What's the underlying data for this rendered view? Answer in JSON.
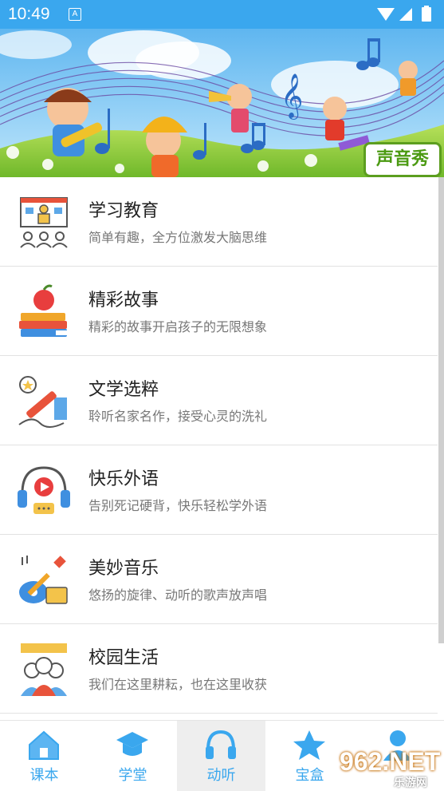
{
  "status_bar": {
    "time": "10:49",
    "notification_badge": "A"
  },
  "banner": {
    "badge_text": "声音秀"
  },
  "list": {
    "items": [
      {
        "title": "学习教育",
        "subtitle": "简单有趣，全方位激发大脑思维",
        "icon": "classroom-icon"
      },
      {
        "title": "精彩故事",
        "subtitle": "精彩的故事开启孩子的无限想象",
        "icon": "books-apple-icon"
      },
      {
        "title": "文学选粹",
        "subtitle": "聆听名家名作，接受心灵的洗礼",
        "icon": "pen-writing-icon"
      },
      {
        "title": "快乐外语",
        "subtitle": "告别死记硬背，快乐轻松学外语",
        "icon": "headphones-play-icon"
      },
      {
        "title": "美妙音乐",
        "subtitle": "悠扬的旋律、动听的歌声放声唱",
        "icon": "guitar-icon"
      },
      {
        "title": "校园生活",
        "subtitle": "我们在这里耕耘，也在这里收获",
        "icon": "students-icon"
      }
    ]
  },
  "tabbar": {
    "tabs": [
      {
        "label": "课本",
        "icon": "house-icon",
        "active": false
      },
      {
        "label": "学堂",
        "icon": "graduation-cap-icon",
        "active": false
      },
      {
        "label": "动听",
        "icon": "headphones-icon",
        "active": true
      },
      {
        "label": "宝盒",
        "icon": "star-icon",
        "active": false
      },
      {
        "label": "",
        "icon": "user-icon",
        "active": false
      }
    ]
  },
  "watermark": {
    "big": "962.NET",
    "small": "乐游网"
  },
  "colors": {
    "accent": "#3aa7ee",
    "title_text": "#222222",
    "subtitle_text": "#777777",
    "divider": "#e2e2e2"
  }
}
